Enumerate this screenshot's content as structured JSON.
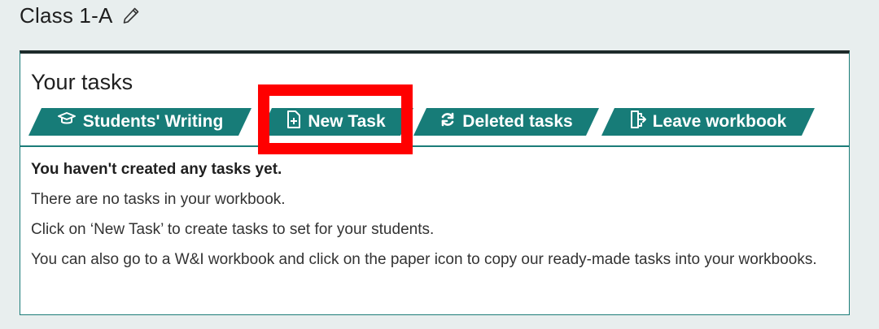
{
  "header": {
    "class_name": "Class 1-A",
    "edit_icon": "pencil-icon"
  },
  "card": {
    "title": "Your tasks",
    "tabs": [
      {
        "label": "Students' Writing",
        "icon": "graduation-cap-icon"
      },
      {
        "label": "New Task",
        "icon": "new-file-icon"
      },
      {
        "label": "Deleted tasks",
        "icon": "refresh-icon"
      },
      {
        "label": "Leave workbook",
        "icon": "exit-door-icon"
      }
    ],
    "empty_state": {
      "heading": "You haven't created any tasks yet.",
      "line1": "There are no tasks in your workbook.",
      "line2": "Click on ‘New Task’ to create tasks to set for your students.",
      "line3": "You can also go to a W&I workbook and click on the paper icon to copy our ready-made tasks into your workbooks."
    }
  },
  "colors": {
    "accent": "#177c78",
    "highlight": "#ff0000",
    "background": "#e8eeee"
  }
}
